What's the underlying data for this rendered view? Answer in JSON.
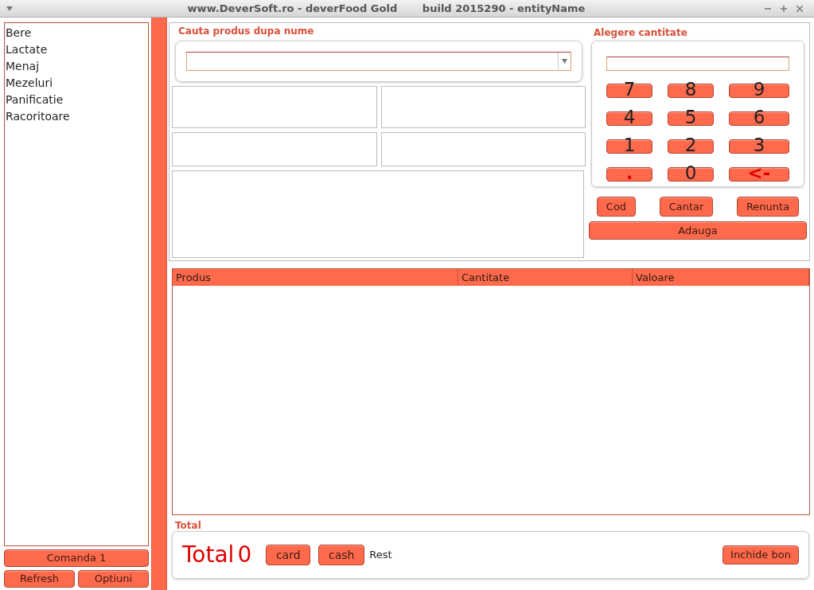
{
  "window": {
    "title": "www.DeverSoft.ro - deverFood Gold       build 2015290 - entityName"
  },
  "categories": [
    "Bere",
    "Lactate",
    "Menaj",
    "Mezeluri",
    "Panificatie",
    "Racoritoare"
  ],
  "left_buttons": {
    "order": "Comanda 1",
    "refresh": "Refresh",
    "options": "Optiuni"
  },
  "search": {
    "title": "Cauta produs dupa nume"
  },
  "quantity": {
    "title": "Alegere cantitate",
    "keys": [
      {
        "label": "7",
        "kind": "digit"
      },
      {
        "label": "8",
        "kind": "digit"
      },
      {
        "label": "9",
        "kind": "digit"
      },
      {
        "label": "4",
        "kind": "digit"
      },
      {
        "label": "5",
        "kind": "digit"
      },
      {
        "label": "6",
        "kind": "digit"
      },
      {
        "label": "1",
        "kind": "digit"
      },
      {
        "label": "2",
        "kind": "digit"
      },
      {
        "label": "3",
        "kind": "digit"
      },
      {
        "label": ".",
        "kind": "symbol"
      },
      {
        "label": "0",
        "kind": "digit"
      },
      {
        "label": "<-",
        "kind": "symbol"
      }
    ],
    "actions": [
      "Cod",
      "Cantar",
      "Renunta"
    ],
    "add": "Adauga"
  },
  "table": {
    "columns": [
      "Produs",
      "Cantitate",
      "Valoare"
    ]
  },
  "total": {
    "title": "Total",
    "label": "Total",
    "value": "0",
    "card": "card",
    "cash": "cash",
    "rest": "Rest",
    "close": "Inchide bon"
  }
}
